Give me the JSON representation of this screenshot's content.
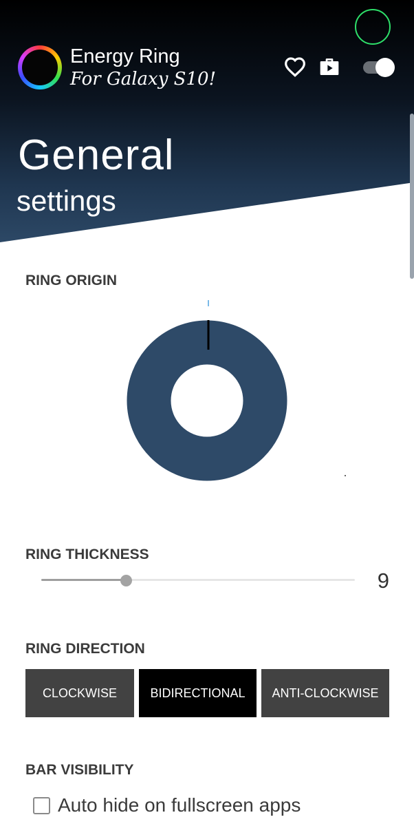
{
  "app": {
    "title": "Energy Ring",
    "subtitle": "For Galaxy S10!",
    "logo_icon": "energy-ring-logo"
  },
  "header": {
    "favorite_icon": "heart-icon",
    "store_icon": "play-store-icon",
    "master_toggle": {
      "state": "on"
    }
  },
  "page": {
    "title": "General",
    "subtitle": "settings"
  },
  "sections": {
    "ring_origin": {
      "label": "RING ORIGIN"
    },
    "ring_thickness": {
      "label": "RING THICKNESS",
      "value": "9",
      "slider_fraction": 0.27
    },
    "ring_direction": {
      "label": "RING DIRECTION",
      "options": [
        "CLOCKWISE",
        "BIDIRECTIONAL",
        "ANTI-CLOCKWISE"
      ],
      "selected": "BIDIRECTIONAL"
    },
    "bar_visibility": {
      "label": "BAR VISIBILITY",
      "auto_hide_label": "Auto hide on fullscreen apps",
      "auto_hide_checked": false
    }
  },
  "colors": {
    "ring": "#2e4a68",
    "camera_indicator": "#2ee06a",
    "selected_button": "#000000",
    "button": "#424242"
  }
}
